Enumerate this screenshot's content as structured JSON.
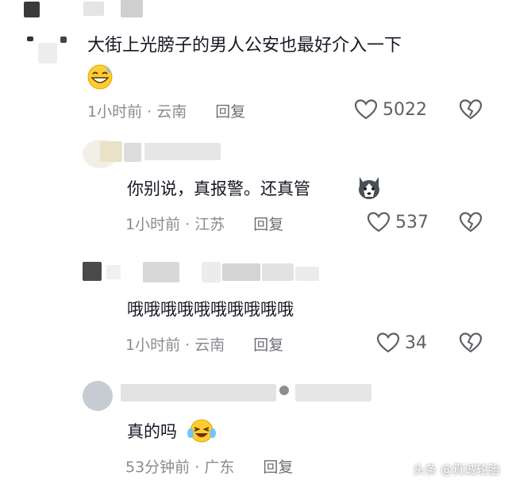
{
  "comments": [
    {
      "text": "大街上光膀子的男人公安也最好介入一下",
      "emoji": "grinning-sweat-emoji",
      "time": "1小时前",
      "location": "云南",
      "reply_label": "回复",
      "likes": "5022"
    },
    {
      "text": "你别说，真报警。还真管",
      "emoji": "husky-dog-emoji",
      "time": "1小时前",
      "location": "江苏",
      "reply_label": "回复",
      "likes": "537"
    },
    {
      "text": "哦哦哦哦哦哦哦哦哦哦",
      "time": "1小时前",
      "location": "云南",
      "reply_label": "回复",
      "likes": "34"
    },
    {
      "text": "真的吗",
      "emoji": "laughing-tears-emoji",
      "time": "53分钟前",
      "location": "广东",
      "reply_label": "回复"
    }
  ],
  "watermark": "头条 @真诚轮胎",
  "colors": {
    "text": "#161823",
    "meta": "#8a8b91",
    "icon": "#5e5f66"
  }
}
